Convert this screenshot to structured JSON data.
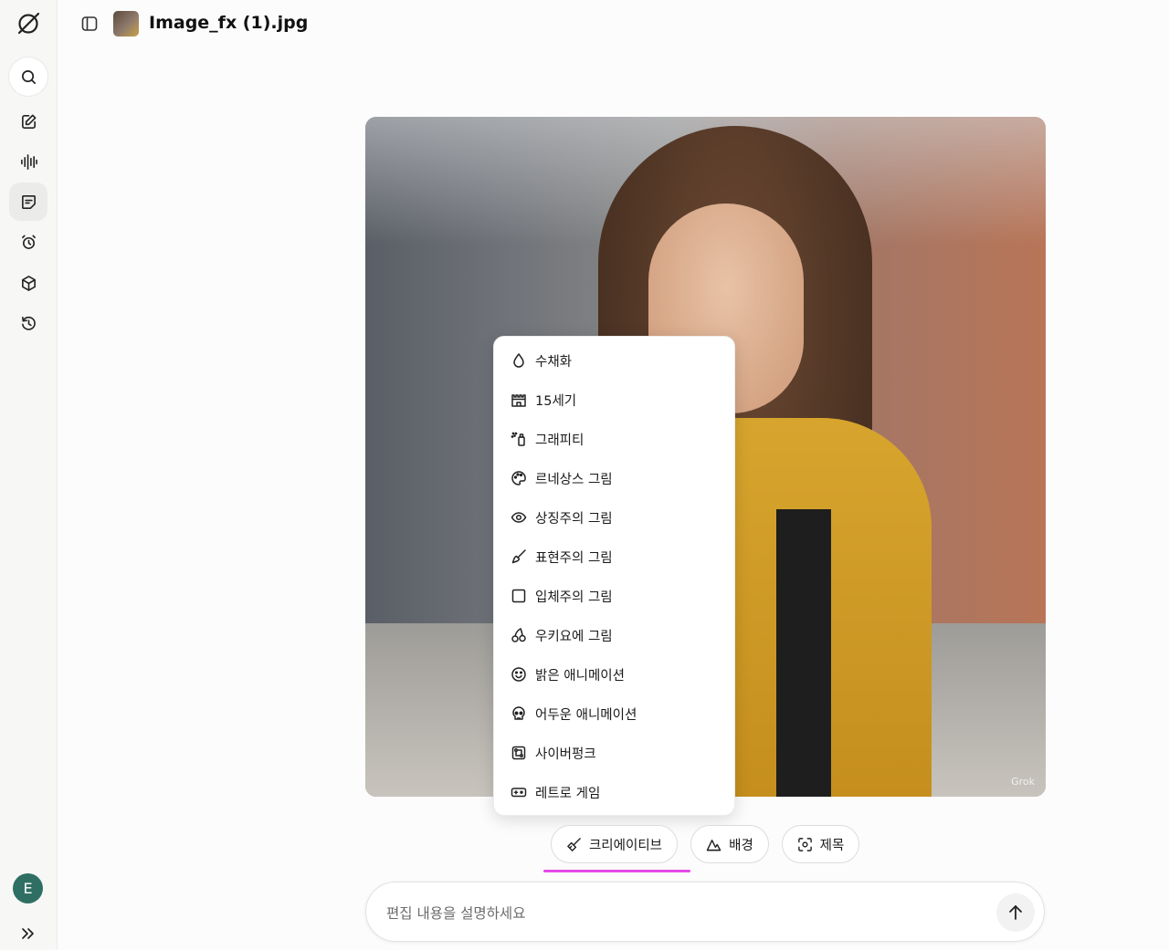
{
  "header": {
    "file_name": "Image_fx (1).jpg"
  },
  "user": {
    "avatar_initial": "E"
  },
  "image": {
    "watermark": "Grok"
  },
  "style_menu": {
    "items": [
      {
        "label": "수채화",
        "icon": "water-drop-icon"
      },
      {
        "label": "15세기",
        "icon": "castle-icon"
      },
      {
        "label": "그래피티",
        "icon": "spray-can-icon"
      },
      {
        "label": "르네상스 그림",
        "icon": "palette-icon"
      },
      {
        "label": "상징주의 그림",
        "icon": "eye-icon"
      },
      {
        "label": "표현주의 그림",
        "icon": "brush-icon"
      },
      {
        "label": "입체주의 그림",
        "icon": "square-icon"
      },
      {
        "label": "우키요에 그림",
        "icon": "cherry-icon"
      },
      {
        "label": "밝은 애니메이션",
        "icon": "smile-icon"
      },
      {
        "label": "어두운 애니메이션",
        "icon": "skull-icon"
      },
      {
        "label": "사이버펑크",
        "icon": "circuit-icon"
      },
      {
        "label": "레트로 게임",
        "icon": "gamepad-icon"
      }
    ]
  },
  "toolbar": {
    "creative_label": "크리에이티브",
    "background_label": "배경",
    "title_label": "제목"
  },
  "composer": {
    "placeholder": "편집 내용을 설명하세요"
  },
  "colors": {
    "accent_underline": "#e54ae8",
    "avatar_bg": "#2f6f63"
  }
}
